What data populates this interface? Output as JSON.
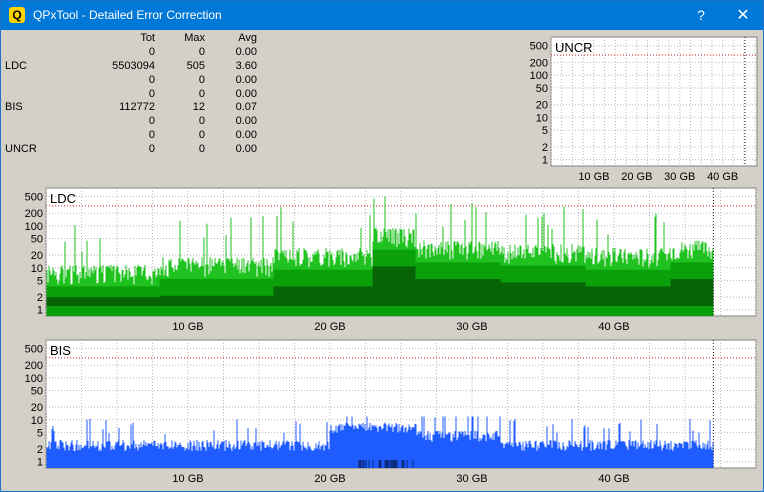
{
  "window": {
    "title": "QPxTool - Detailed Error Correction",
    "help_label": "?",
    "close_label": "✕",
    "app_icon_letter": "Q",
    "titlebar_color": "#0078d7"
  },
  "stats": {
    "headers": [
      "",
      "Tot",
      "Max",
      "Avg"
    ],
    "rows": [
      {
        "name": "",
        "tot": "0",
        "max": "0",
        "avg": "0.00"
      },
      {
        "name": "LDC",
        "tot": "5503094",
        "max": "505",
        "avg": "3.60"
      },
      {
        "name": "",
        "tot": "0",
        "max": "0",
        "avg": "0.00"
      },
      {
        "name": "",
        "tot": "0",
        "max": "0",
        "avg": "0.00"
      },
      {
        "name": "BIS",
        "tot": "112772",
        "max": "12",
        "avg": "0.07"
      },
      {
        "name": "",
        "tot": "0",
        "max": "0",
        "avg": "0.00"
      },
      {
        "name": "",
        "tot": "0",
        "max": "0",
        "avg": "0.00"
      },
      {
        "name": "UNCR",
        "tot": "0",
        "max": "0",
        "avg": "0.00"
      }
    ]
  },
  "chart_data": [
    {
      "type": "bar",
      "title": "UNCR",
      "y_scale": "log",
      "yticks": [
        "500",
        "200",
        "100",
        "50",
        "20",
        "10",
        "5",
        "2",
        "1"
      ],
      "xticks": [
        "10 GB",
        "20 GB",
        "30 GB",
        "40 GB"
      ],
      "xlim_gb": [
        0,
        48
      ],
      "values": [
        0
      ],
      "color": "#0a8a0a"
    },
    {
      "type": "bar",
      "title": "LDC",
      "y_scale": "log",
      "yticks": [
        "500",
        "200",
        "100",
        "50",
        "20",
        "10",
        "5",
        "2",
        "1"
      ],
      "xticks": [
        "10 GB",
        "20 GB",
        "30 GB",
        "40 GB"
      ],
      "xlim_gb": [
        0,
        50
      ],
      "data_end_gb": 47,
      "segments_gb": [
        [
          0,
          8,
          8
        ],
        [
          8,
          16,
          12
        ],
        [
          16,
          23,
          20
        ],
        [
          23,
          26,
          60
        ],
        [
          26,
          32,
          30
        ],
        [
          32,
          38,
          25
        ],
        [
          38,
          44,
          20
        ],
        [
          44,
          47,
          30
        ]
      ],
      "max": 505,
      "avg": 3.6,
      "colors": {
        "peak": "#1fc21f",
        "main": "#0aa00a",
        "avg": "#066406"
      }
    },
    {
      "type": "bar",
      "title": "BIS",
      "y_scale": "log",
      "yticks": [
        "500",
        "200",
        "100",
        "50",
        "20",
        "10",
        "5",
        "2",
        "1"
      ],
      "xticks": [
        "10 GB",
        "20 GB",
        "30 GB",
        "40 GB"
      ],
      "xlim_gb": [
        0,
        50
      ],
      "data_end_gb": 47,
      "segments_gb": [
        [
          0,
          20,
          3
        ],
        [
          20,
          26,
          8
        ],
        [
          26,
          32,
          5
        ],
        [
          32,
          47,
          3
        ]
      ],
      "max": 12,
      "avg": 0.07,
      "colors": {
        "main": "#1f5cff",
        "dark": "#0b2a80"
      }
    }
  ]
}
